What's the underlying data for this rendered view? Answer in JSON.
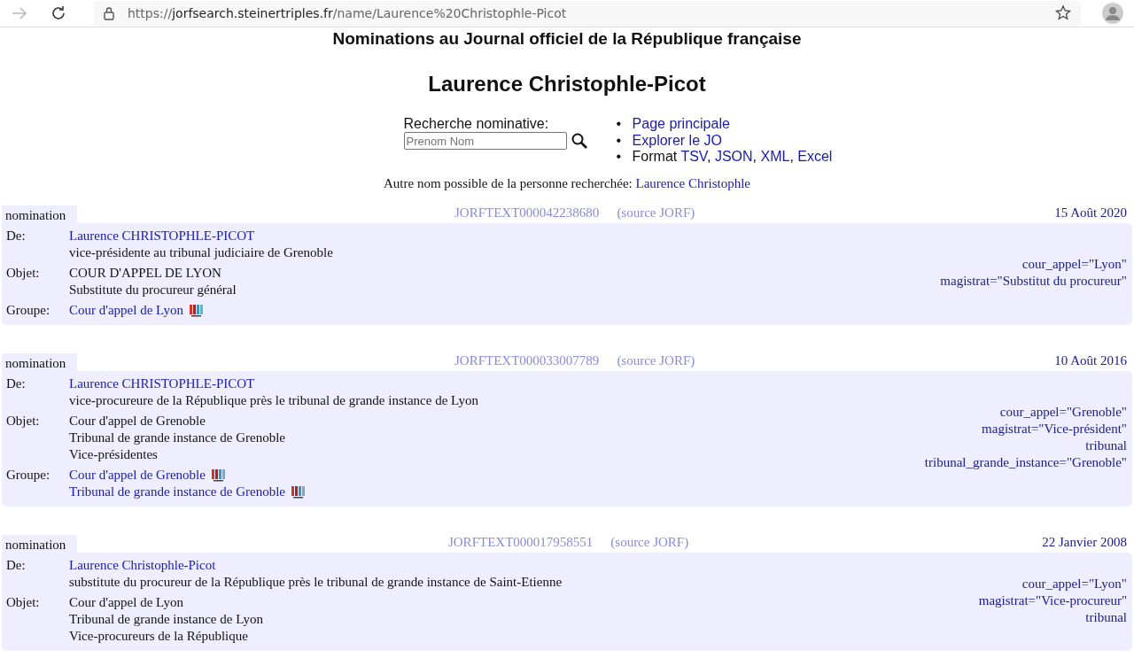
{
  "browser": {
    "url_prefix": "https://",
    "url_host": "jorfsearch.steinertriples.fr",
    "url_path": "/name/Laurence%20Christophle-Picot"
  },
  "page": {
    "heading": "Nominations au Journal officiel de la République française",
    "person": "Laurence Christophle-Picot",
    "search": {
      "label": "Recherche nominative:",
      "placeholder": "Prenom Nom"
    },
    "menu": [
      {
        "bullet": "•",
        "parts": [
          {
            "text": "Page principale",
            "link": true
          }
        ]
      },
      {
        "bullet": "•",
        "parts": [
          {
            "text": "Explorer le JO",
            "link": true
          }
        ]
      },
      {
        "bullet": "•",
        "parts": [
          {
            "text": "Format ",
            "link": false
          },
          {
            "text": "TSV",
            "link": true
          },
          {
            "text": ", ",
            "link": false
          },
          {
            "text": "JSON",
            "link": true
          },
          {
            "text": ", ",
            "link": false
          },
          {
            "text": "XML",
            "link": true
          },
          {
            "text": ", ",
            "link": false
          },
          {
            "text": "Excel",
            "link": true
          }
        ]
      }
    ],
    "alternative": {
      "text": "Autre nom possible de la personne recherchée:",
      "name": "Laurence Christophle"
    }
  },
  "entries": [
    {
      "type": "nomination",
      "text_id": "JORFTEXT000042238680",
      "source": "(source JORF)",
      "date": "15 Août 2020",
      "rows": [
        {
          "label": "De:",
          "lines": [
            {
              "text": "Laurence CHRISTOPHLE-PICOT",
              "link": true,
              "badge": false
            },
            {
              "text": "vice-présidente au tribunal judiciaire de Grenoble",
              "link": false,
              "badge": false
            }
          ]
        },
        {
          "label": "Objet:",
          "lines": [
            {
              "text": "COUR D'APPEL DE LYON",
              "link": false,
              "badge": false
            },
            {
              "text": "Substitute du procureur général",
              "link": false,
              "badge": false
            }
          ]
        },
        {
          "label": "Groupe:",
          "lines": [
            {
              "text": "Cour d'appel de Lyon",
              "link": true,
              "badge": true
            }
          ]
        }
      ],
      "tags": [
        "cour_appel=\"Lyon\"",
        "magistrat=\"Substitut du procureur\""
      ]
    },
    {
      "type": "nomination",
      "text_id": "JORFTEXT000033007789",
      "source": "(source JORF)",
      "date": "10 Août 2016",
      "rows": [
        {
          "label": "De:",
          "lines": [
            {
              "text": "Laurence CHRISTOPHLE-PICOT",
              "link": true,
              "badge": false
            },
            {
              "text": "vice-procureure de la République près le tribunal de grande instance de Lyon",
              "link": false,
              "badge": false
            }
          ]
        },
        {
          "label": "Objet:",
          "lines": [
            {
              "text": "Cour d'appel de Grenoble",
              "link": false,
              "badge": false
            },
            {
              "text": "Tribunal de grande instance de Grenoble",
              "link": false,
              "badge": false
            },
            {
              "text": "Vice-présidentes",
              "link": false,
              "badge": false
            }
          ]
        },
        {
          "label": "Groupe:",
          "lines": [
            {
              "text": "Cour d'appel de Grenoble",
              "link": true,
              "badge": true
            },
            {
              "text": "Tribunal de grande instance de Grenoble",
              "link": true,
              "badge": true
            }
          ]
        }
      ],
      "tags": [
        "cour_appel=\"Grenoble\"",
        "magistrat=\"Vice-président\"",
        "tribunal",
        "tribunal_grande_instance=\"Grenoble\""
      ]
    },
    {
      "type": "nomination",
      "text_id": "JORFTEXT000017958551",
      "source": "(source JORF)",
      "date": "22 Janvier 2008",
      "rows": [
        {
          "label": "De:",
          "lines": [
            {
              "text": "Laurence Christophle-Picot",
              "link": true,
              "badge": false
            },
            {
              "text": "substitute du procureur de la République près le tribunal de grande instance de Saint-Etienne",
              "link": false,
              "badge": false
            }
          ]
        },
        {
          "label": "Objet:",
          "lines": [
            {
              "text": "Cour d'appel de Lyon",
              "link": false,
              "badge": false
            },
            {
              "text": "Tribunal de grande instance de Lyon",
              "link": false,
              "badge": false
            },
            {
              "text": "Vice-procureurs de la République",
              "link": false,
              "badge": false
            }
          ]
        }
      ],
      "tags": [
        "cour_appel=\"Lyon\"",
        "magistrat=\"Vice-procureur\"",
        "tribunal"
      ]
    }
  ]
}
